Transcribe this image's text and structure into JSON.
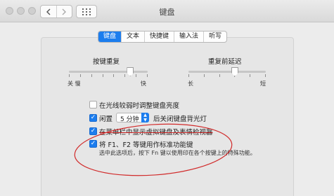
{
  "window": {
    "title": "键盘"
  },
  "tabs": [
    {
      "label": "键盘",
      "active": true
    },
    {
      "label": "文本",
      "active": false
    },
    {
      "label": "快捷键",
      "active": false
    },
    {
      "label": "输入法",
      "active": false
    },
    {
      "label": "听写",
      "active": false
    }
  ],
  "sliders": {
    "repeat": {
      "label": "按键重复",
      "left": "关 慢",
      "right": "快",
      "value": 0.78
    },
    "delay": {
      "label": "重复前延迟",
      "left": "长",
      "right": "短",
      "value": 0.6
    }
  },
  "options": {
    "brightness": {
      "label": "在光线较弱时调整键盘亮度",
      "checked": false
    },
    "idle_prefix": "闲置",
    "idle_value": "5 分钟",
    "idle_suffix": "后关闭键盘背光灯",
    "idle_checked": true,
    "menubar": {
      "label": "在菜单栏中显示虚拟键盘及表情检视器",
      "checked": true
    },
    "fnkeys": {
      "label": "将 F1、F2 等键用作标准功能键",
      "checked": true,
      "description": "选中此选项后，按下 Fn 键以使用印在各个按键上的特殊功能。"
    }
  },
  "annotation": {
    "color": "#d12a2a"
  },
  "colors": {
    "accent": "#1c7dee"
  }
}
